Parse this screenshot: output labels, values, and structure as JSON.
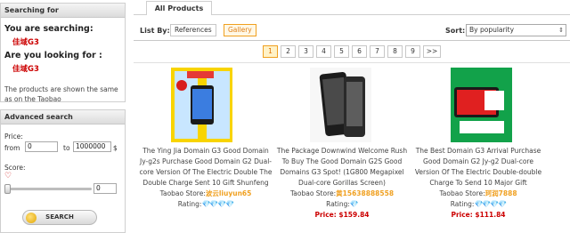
{
  "sidebar": {
    "search_box_title": "Searching for",
    "you_searching_label": "You are searching:",
    "search_term": "佳域G3",
    "looking_for_label": "Are you looking for :",
    "suggestion": "佳域G3",
    "note": "The products are shown the same as on the Taobao",
    "advanced_title": "Advanced search",
    "price_label": "Price:",
    "price_from_label": "from",
    "price_from": "0",
    "price_to_label": "to",
    "price_to": "1000000",
    "currency": "$",
    "score_label": "Score:",
    "score_value": "0",
    "search_button": "SEARCH"
  },
  "main": {
    "tab_label": "All Products",
    "list_by_label": "List By:",
    "view_references": "References",
    "view_gallery": "Gallery",
    "sort_label": "Sort:",
    "sort_value": "By popularity",
    "pages": [
      "1",
      "2",
      "3",
      "4",
      "5",
      "6",
      "7",
      "8",
      "9",
      ">>"
    ],
    "current_page": "1"
  },
  "products": [
    {
      "title": "The Ying Jia Domain G3 Good Domain Jy-g2s Purchase Good Domain G2 Dual-core Version Of The Electric Double The Double Charge Sent 10 Gift Shunfeng",
      "store_label": "Taobao Store:",
      "store": "波云liuyun65",
      "rating_label": "Rating:",
      "rating_icons": "💎💎💎💎",
      "price": ""
    },
    {
      "title": "The Package Downwind Welcome Rush To Buy The Good Domain G2S Good Domains G3 Spot! (1G800 Megapixel Dual-core Gorillas Screen)",
      "store_label": "Taobao Store:",
      "store": "黄15638888558",
      "rating_label": "Rating:",
      "rating_icons": "💎",
      "price": "Price: $159.84"
    },
    {
      "title": "The Best Domain G3 Arrival Purchase Good Domain G2 Jy-g2 Dual-core Version Of The Electric Double-double Charge To Send 10 Major Gift",
      "store_label": "Taobao Store:",
      "store": "珂润7888",
      "rating_label": "Rating:",
      "rating_icons": "💎💎💎💎",
      "price": "Price: $111.84"
    }
  ],
  "colors": {
    "accent_orange": "#f0a020",
    "price_red": "#cc0000",
    "term_red": "#cc0000"
  }
}
